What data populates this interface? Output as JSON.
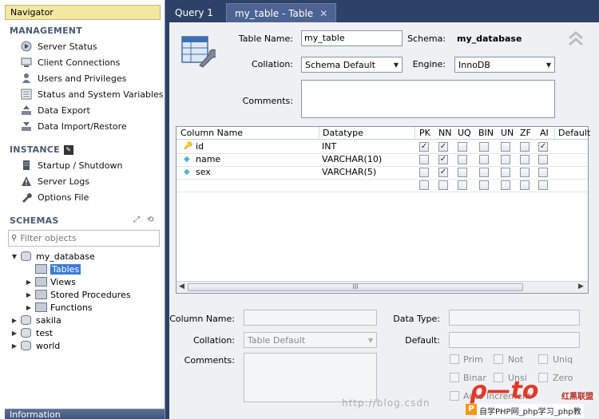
{
  "navigator": {
    "title": "Navigator",
    "management": {
      "header": "MANAGEMENT",
      "items": [
        "Server Status",
        "Client Connections",
        "Users and Privileges",
        "Status and System Variables",
        "Data Export",
        "Data Import/Restore"
      ]
    },
    "instance": {
      "header": "INSTANCE",
      "items": [
        "Startup / Shutdown",
        "Server Logs",
        "Options File"
      ]
    },
    "schemas": {
      "header": "SCHEMAS",
      "filter_placeholder": "Filter objects",
      "tree": {
        "db": "my_database",
        "children": [
          "Tables",
          "Views",
          "Stored Procedures",
          "Functions"
        ],
        "others": [
          "sakila",
          "test",
          "world"
        ]
      }
    },
    "info_label": "Information"
  },
  "tabs": [
    {
      "label": "Query 1"
    },
    {
      "label": "my_table - Table"
    }
  ],
  "table_editor": {
    "table_name_label": "Table Name:",
    "table_name_value": "my_table",
    "schema_label": "Schema:",
    "schema_value": "my_database",
    "collation_label": "Collation:",
    "collation_value": "Schema Default",
    "engine_label": "Engine:",
    "engine_value": "InnoDB",
    "comments_label": "Comments:"
  },
  "grid": {
    "headers": [
      "Column Name",
      "Datatype",
      "PK",
      "NN",
      "UQ",
      "BIN",
      "UN",
      "ZF",
      "AI",
      "Default"
    ],
    "rows": [
      {
        "name": "id",
        "type": "INT",
        "flags": [
          true,
          true,
          false,
          false,
          false,
          false,
          true
        ]
      },
      {
        "name": "name",
        "type": "VARCHAR(10)",
        "flags": [
          false,
          true,
          false,
          false,
          false,
          false,
          false
        ]
      },
      {
        "name": "sex",
        "type": "VARCHAR(5)",
        "flags": [
          false,
          true,
          false,
          false,
          false,
          false,
          false
        ]
      },
      {
        "name": "",
        "type": "",
        "flags": [
          false,
          false,
          false,
          false,
          false,
          false,
          false
        ]
      }
    ],
    "scroll_grip": "III"
  },
  "details": {
    "column_name_label": "Column Name:",
    "collation_label": "Collation:",
    "collation_value": "Table Default",
    "comments_label": "Comments:",
    "data_type_label": "Data Type:",
    "default_label": "Default:",
    "options": [
      "Prim",
      "Not",
      "Uniq",
      "Binar",
      "Unsi",
      "Zero",
      "Auto Increment"
    ]
  },
  "watermark": "http://blog.csdn",
  "logo": {
    "big": "ρ—to",
    "red": "红黑联盟",
    "sub": "自学PHP网_php学习_php教",
    "pbox": "P"
  },
  "colors": {
    "accent": "#3a7bd5",
    "nav_title_bg": "#f3e7a2",
    "tab_bg": "#2e4166"
  }
}
